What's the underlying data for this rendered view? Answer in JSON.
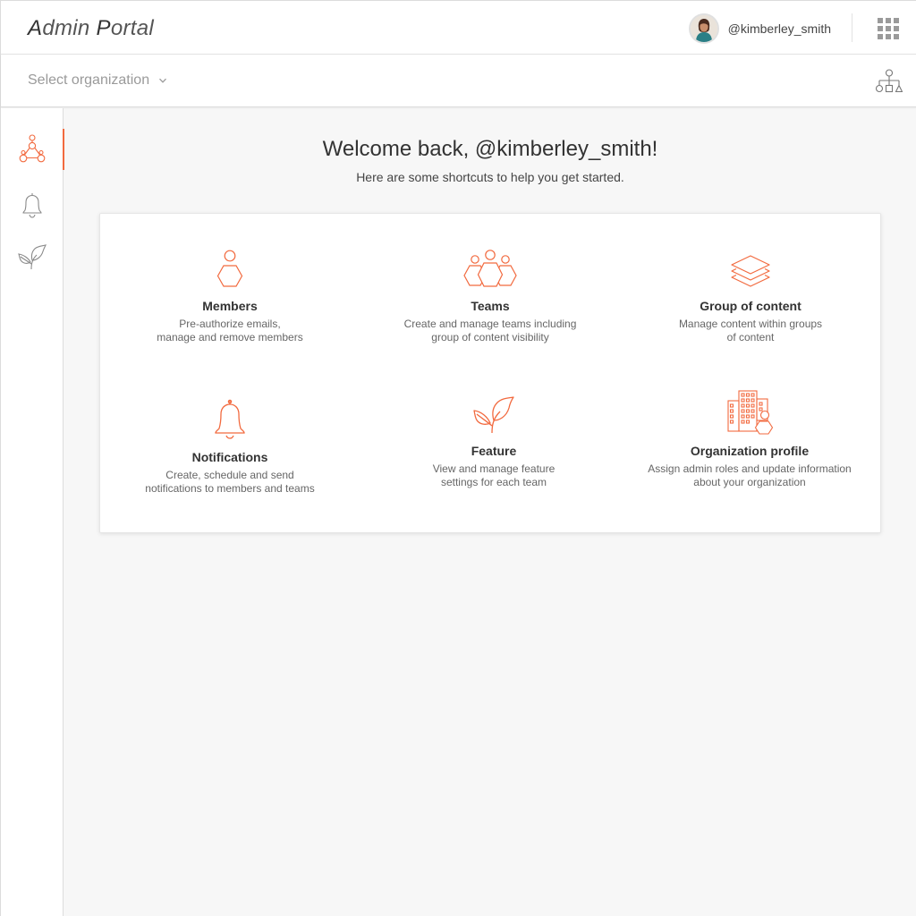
{
  "header": {
    "brand_first_cap": "A",
    "brand_rest_1": "dmin ",
    "brand_second_cap": "P",
    "brand_rest_2": "ortal",
    "username": "@kimberley_smith"
  },
  "org_bar": {
    "select_placeholder": "Select organization"
  },
  "sidebar": {
    "items": [
      {
        "icon": "team-network-icon",
        "active": true
      },
      {
        "icon": "bell-icon",
        "active": false
      },
      {
        "icon": "sprout-icon",
        "active": false
      }
    ]
  },
  "main": {
    "welcome": "Welcome back, @kimberley_smith!",
    "subtitle": "Here are some shortcuts to help you get started."
  },
  "shortcuts": [
    {
      "icon": "member-icon",
      "title": "Members",
      "description": "Pre-authorize emails,\nmanage and remove members"
    },
    {
      "icon": "teams-icon",
      "title": "Teams",
      "description": "Create and manage teams including\ngroup of content visibility"
    },
    {
      "icon": "layers-icon",
      "title": "Group of content",
      "description": "Manage content within groups\nof content"
    },
    {
      "icon": "bell-icon",
      "title": "Notifications",
      "description": "Create, schedule and send\nnotifications to members and teams"
    },
    {
      "icon": "sprout-icon",
      "title": "Feature",
      "description": "View and manage feature\nsettings for each team"
    },
    {
      "icon": "building-icon",
      "title": "Organization profile",
      "description": "Assign admin roles and update information\nabout your organization"
    }
  ],
  "colors": {
    "accent": "#f26a3f",
    "icon_gray": "#8a8a8a",
    "text_dark": "#333333",
    "text_muted": "#666666",
    "background": "#f7f7f7"
  }
}
